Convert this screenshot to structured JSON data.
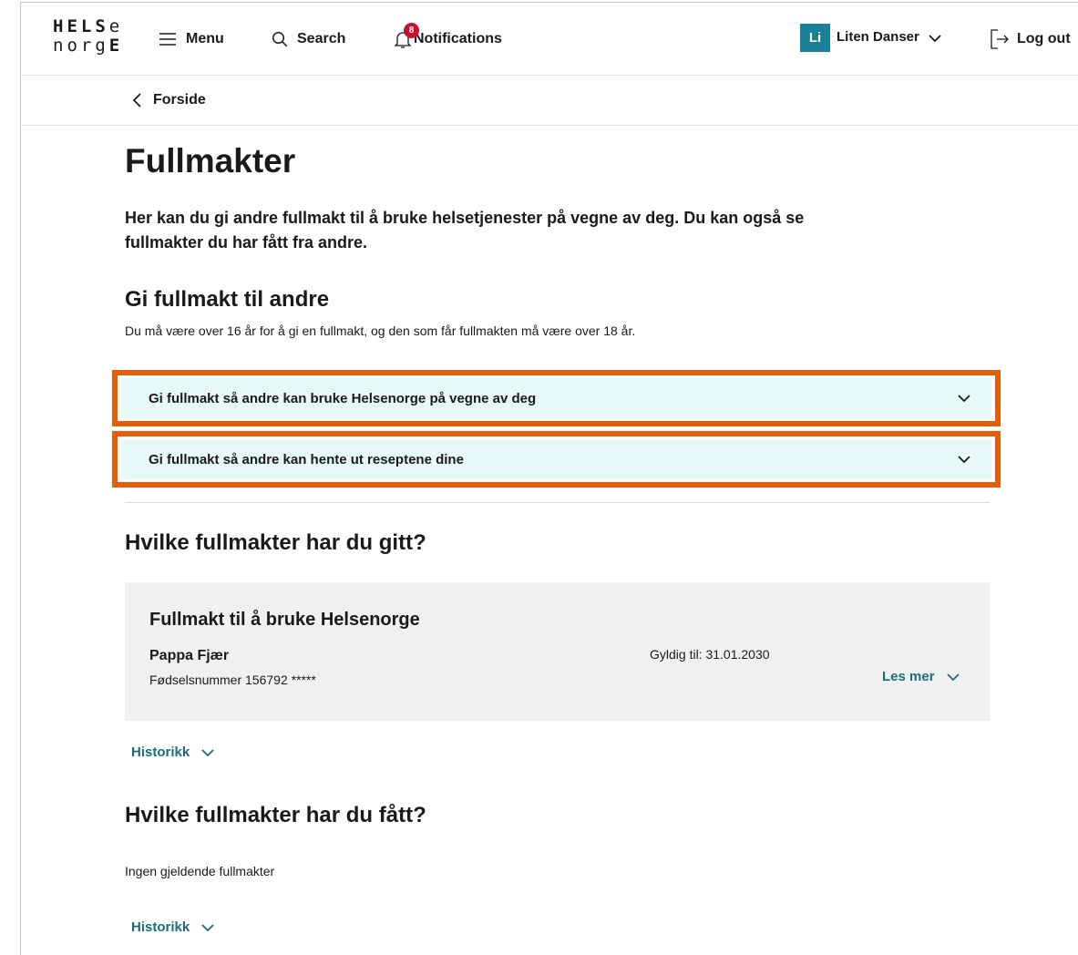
{
  "header": {
    "logo_top": "HELSe",
    "logo_bottom": "norgE",
    "menu_label": "Menu",
    "search_label": "Search",
    "notifications_label": "Notifications",
    "notification_count": "8",
    "user_initials": "Li",
    "user_name": "Liten Danser",
    "logout_label": "Log out"
  },
  "breadcrumb": {
    "label": "Forside"
  },
  "page": {
    "title": "Fullmakter",
    "lead": "Her kan du gi andre fullmakt til å bruke helsetjenester på vegne av deg. Du kan også se fullmakter du har fått fra andre."
  },
  "give": {
    "heading": "Gi fullmakt til andre",
    "note": "Du må være over 16 år for å gi en fullmakt, og den som får fullmakten må være over 18 år.",
    "accordions": [
      {
        "label": "Gi fullmakt så andre kan bruke Helsenorge på vegne av deg"
      },
      {
        "label": "Gi fullmakt så andre kan hente ut reseptene dine"
      }
    ]
  },
  "given": {
    "heading": "Hvilke fullmakter har du gitt?",
    "card": {
      "title": "Fullmakt til å bruke Helsenorge",
      "name": "Pappa Fjær",
      "id": "Fødselsnummer 156792 *****",
      "valid": "Gyldig til: 31.01.2030",
      "more_label": "Les mer"
    },
    "history_label": "Historikk"
  },
  "received": {
    "heading": "Hvilke fullmakter har du fått?",
    "empty_text": "Ingen gjeldende fullmakter",
    "history_label": "Historikk"
  },
  "colors": {
    "accent_teal": "#188097",
    "link_teal": "#1b6c7d",
    "highlight_orange": "#e35d0a",
    "accordion_bg": "#e6f8f8",
    "badge_red": "#c8102e"
  }
}
